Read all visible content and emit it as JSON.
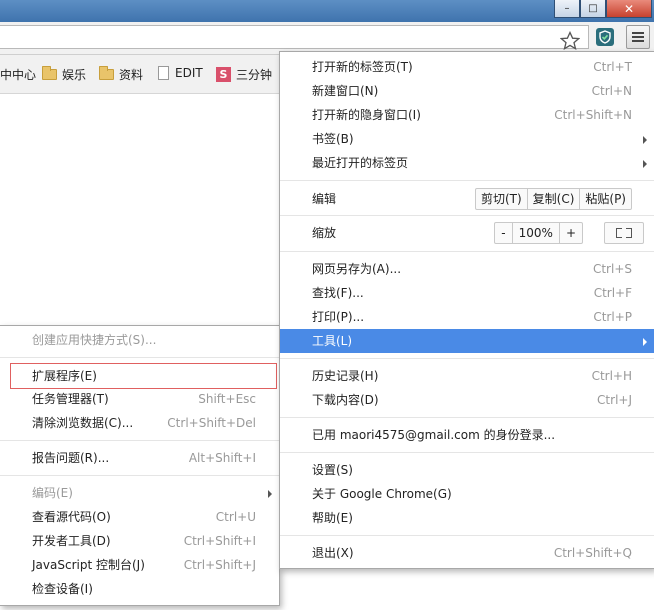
{
  "titlebar": {
    "min": "–",
    "max": "□",
    "close": "✕"
  },
  "bookmarks": [
    {
      "label": "中中心",
      "icon": "none"
    },
    {
      "label": "娱乐",
      "icon": "folder-icon"
    },
    {
      "label": "资料",
      "icon": "folder-icon"
    },
    {
      "label": "EDIT",
      "icon": "page-icon"
    },
    {
      "label": "三分钟",
      "icon": "s-icon"
    }
  ],
  "bookmark_s_glyph": "S",
  "main_menu": {
    "new_tab": {
      "label": "打开新的标签页(T)",
      "shortcut": "Ctrl+T"
    },
    "new_window": {
      "label": "新建窗口(N)",
      "shortcut": "Ctrl+N"
    },
    "incognito": {
      "label": "打开新的隐身窗口(I)",
      "shortcut": "Ctrl+Shift+N"
    },
    "bookmarks": {
      "label": "书签(B)"
    },
    "recent_tabs": {
      "label": "最近打开的标签页"
    },
    "edit": {
      "label": "编辑",
      "cut": "剪切(T)",
      "copy": "复制(C)",
      "paste": "粘贴(P)"
    },
    "zoom": {
      "label": "缩放",
      "minus": "-",
      "value": "100%",
      "plus": "+"
    },
    "save_as": {
      "label": "网页另存为(A)...",
      "shortcut": "Ctrl+S"
    },
    "find": {
      "label": "查找(F)...",
      "shortcut": "Ctrl+F"
    },
    "print": {
      "label": "打印(P)...",
      "shortcut": "Ctrl+P"
    },
    "tools": {
      "label": "工具(L)"
    },
    "history": {
      "label": "历史记录(H)",
      "shortcut": "Ctrl+H"
    },
    "downloads": {
      "label": "下载内容(D)",
      "shortcut": "Ctrl+J"
    },
    "signed_in": {
      "label": "已用 maori4575@gmail.com 的身份登录..."
    },
    "settings": {
      "label": "设置(S)"
    },
    "about": {
      "label": "关于 Google Chrome(G)"
    },
    "help": {
      "label": "帮助(E)"
    },
    "exit": {
      "label": "退出(X)",
      "shortcut": "Ctrl+Shift+Q"
    }
  },
  "tools_menu": {
    "create_shortcut": {
      "label": "创建应用快捷方式(S)..."
    },
    "extensions": {
      "label": "扩展程序(E)"
    },
    "task_manager": {
      "label": "任务管理器(T)",
      "shortcut": "Shift+Esc"
    },
    "clear_data": {
      "label": "清除浏览数据(C)...",
      "shortcut": "Ctrl+Shift+Del"
    },
    "report_issue": {
      "label": "报告问题(R)...",
      "shortcut": "Alt+Shift+I"
    },
    "encoding": {
      "label": "编码(E)"
    },
    "view_source": {
      "label": "查看源代码(O)",
      "shortcut": "Ctrl+U"
    },
    "dev_tools": {
      "label": "开发者工具(D)",
      "shortcut": "Ctrl+Shift+I"
    },
    "js_console": {
      "label": "JavaScript 控制台(J)",
      "shortcut": "Ctrl+Shift+J"
    },
    "inspect_devices": {
      "label": "检查设备(I)"
    }
  },
  "colors": {
    "highlight": "#4a8ae6",
    "highlight_text": "#ffffff",
    "extension_box": "#e06060"
  }
}
